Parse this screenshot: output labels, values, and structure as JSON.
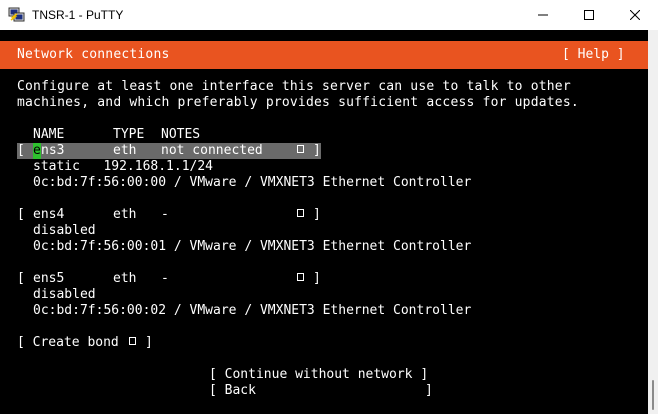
{
  "window": {
    "title": "TNSR-1 - PuTTY",
    "icons": [
      "putty-app-icon",
      "minimize-icon",
      "maximize-icon",
      "close-icon"
    ]
  },
  "header": {
    "title": "Network connections",
    "help_label": "[ Help ]",
    "accent_color": "#e95420"
  },
  "intro": {
    "line1": "Configure at least one interface this server can use to talk to other",
    "line2": "machines, and which preferably provides sufficient access for updates."
  },
  "columns": {
    "name": "NAME",
    "type": "TYPE",
    "notes": "NOTES"
  },
  "interfaces": [
    {
      "open": "[",
      "cursor_char": "e",
      "name_rest": "ns3",
      "name": "ens3",
      "type": "eth",
      "notes": "not connected",
      "close": "]",
      "config": "static   192.168.1.1/24",
      "hw": "0c:bd:7f:56:00:00 / VMware / VMXNET3 Ethernet Controller"
    },
    {
      "open": "[",
      "name": "ens4",
      "type": "eth",
      "notes": "-",
      "close": "]",
      "config": "disabled",
      "hw": "0c:bd:7f:56:00:01 / VMware / VMXNET3 Ethernet Controller"
    },
    {
      "open": "[",
      "name": "ens5",
      "type": "eth",
      "notes": "-",
      "close": "]",
      "config": "disabled",
      "hw": "0c:bd:7f:56:00:02 / VMware / VMXNET3 Ethernet Controller"
    }
  ],
  "create_bond": {
    "open": "[ Create bond",
    "close": "]"
  },
  "actions": {
    "continue_label": "[ Continue without network ]",
    "back_open": "[ Back",
    "back_close": "]"
  },
  "colors": {
    "selection": "#6a6a6a",
    "cursor": "#2ec22e",
    "dim_text": "#8a8a8a"
  }
}
